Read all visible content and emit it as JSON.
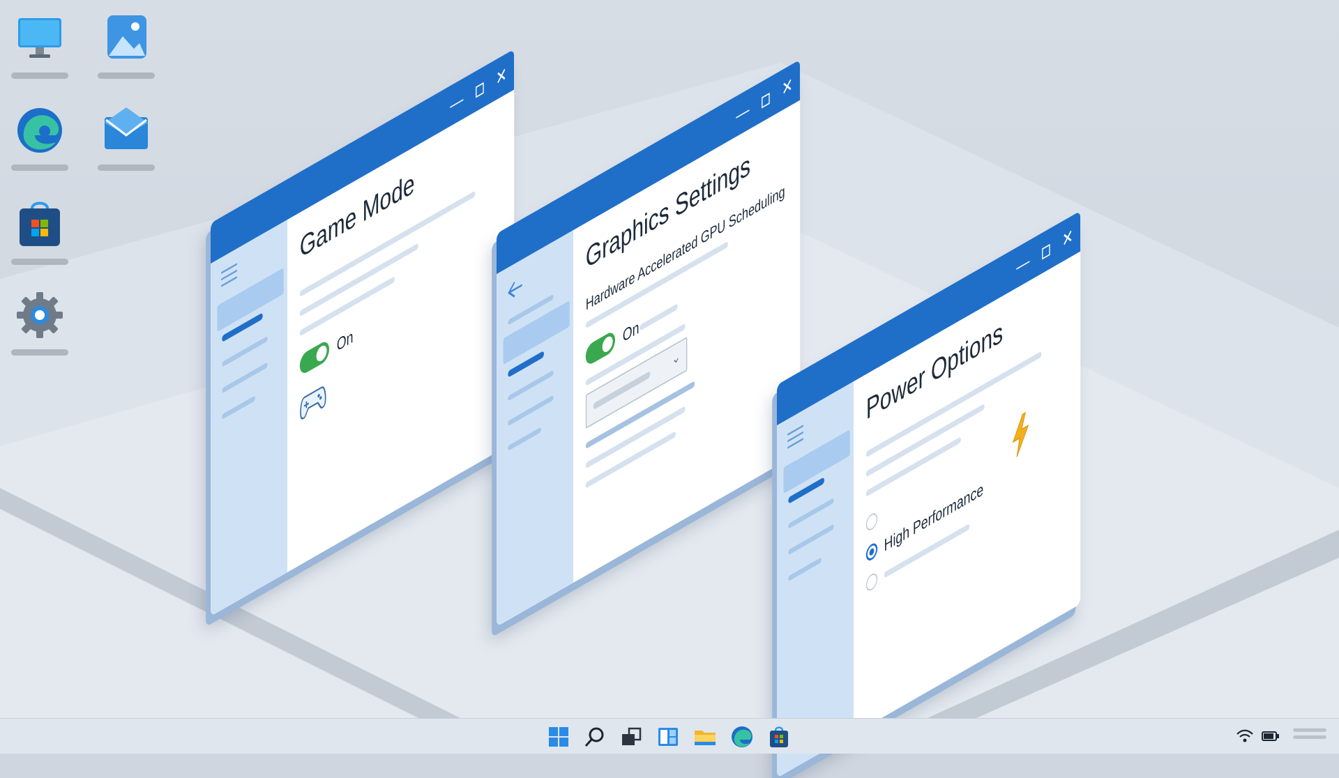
{
  "desktop": {
    "icons": [
      {
        "name": "this-pc-icon"
      },
      {
        "name": "photos-icon"
      },
      {
        "name": "edge-icon"
      },
      {
        "name": "mail-icon"
      },
      {
        "name": "store-icon"
      },
      {
        "name": "settings-icon"
      }
    ]
  },
  "windows": {
    "game_mode": {
      "title": "Game Mode",
      "toggle_label": "On",
      "icon": "gamepad-icon"
    },
    "graphics": {
      "title": "Graphics Settings",
      "subtitle": "Hardware Accelerated GPU Scheduling",
      "toggle_label": "On",
      "icon": "back-arrow-icon"
    },
    "power": {
      "title": "Power Options",
      "selected_option": "High Performance",
      "icon": "lightning-icon"
    },
    "controls": {
      "minimize": "—",
      "close": "✕"
    }
  },
  "colors": {
    "accent": "#1f6fc9",
    "toggle_on": "#3aa84f",
    "sidebar": "#cfe2f5",
    "lightning": "#f2b01e"
  },
  "taskbar": {
    "items": [
      "start-icon",
      "search-icon",
      "task-view-icon",
      "widgets-icon",
      "file-explorer-icon",
      "edge-icon",
      "store-icon"
    ],
    "tray": [
      "wifi-icon",
      "battery-icon",
      "menu-icon"
    ]
  }
}
